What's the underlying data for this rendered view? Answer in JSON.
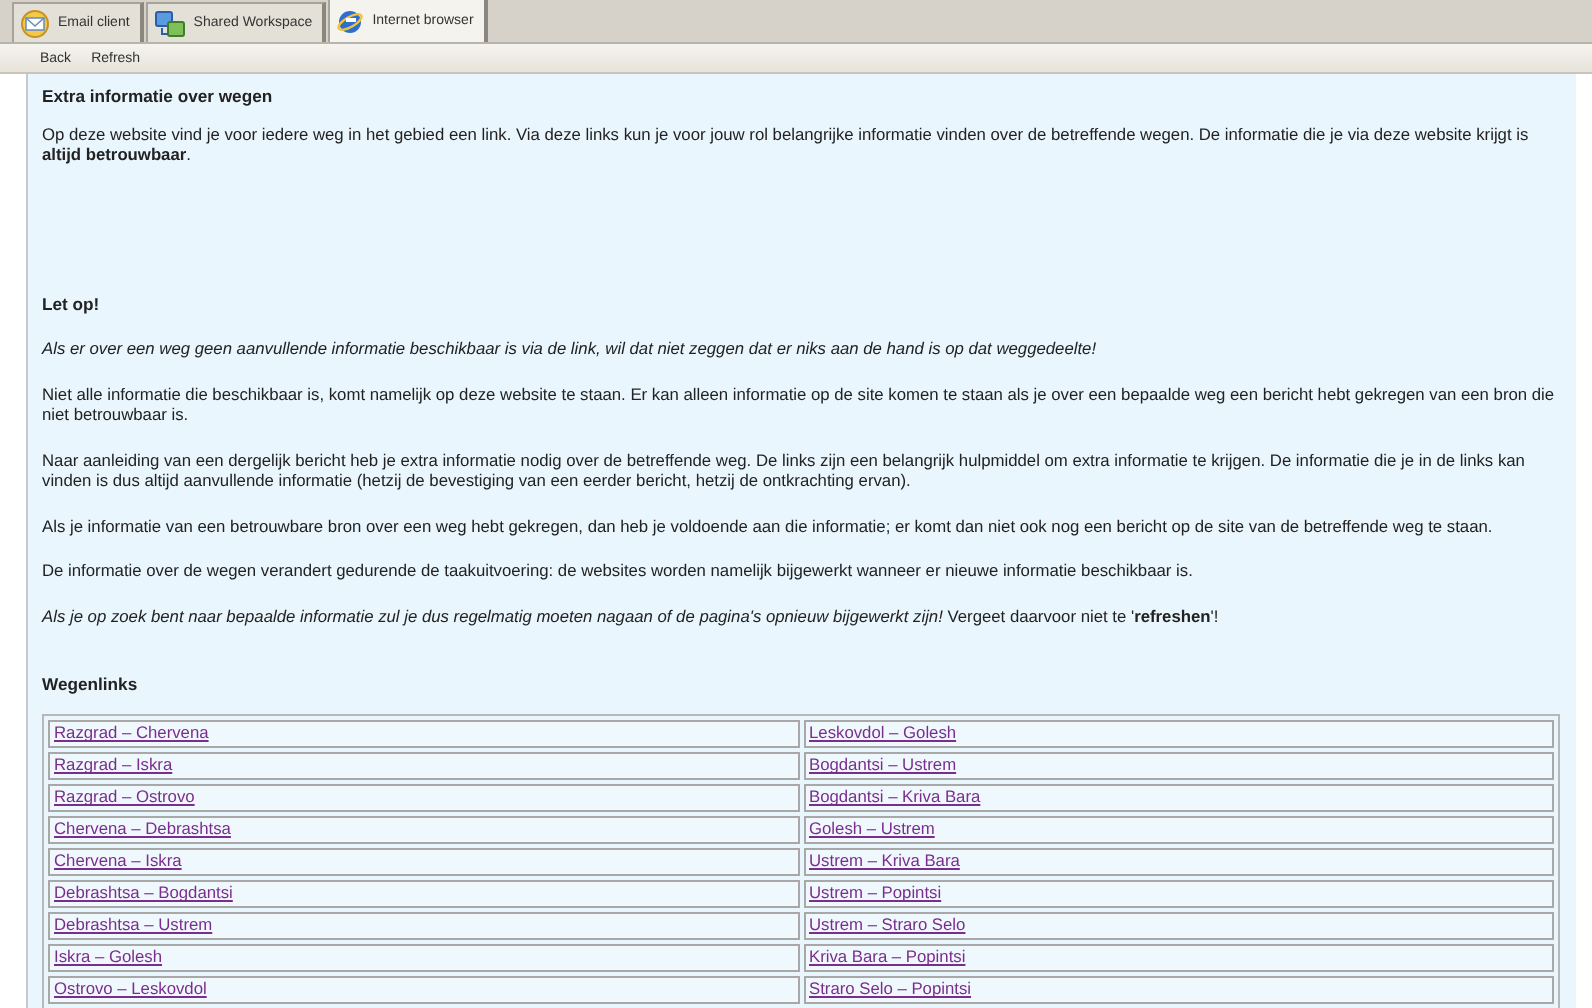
{
  "tabs": [
    {
      "label": "Email client",
      "selected": false
    },
    {
      "label": "Shared Workspace",
      "selected": false
    },
    {
      "label": "Internet browser",
      "selected": true
    }
  ],
  "toolbar": [
    "Back",
    "Refresh"
  ],
  "page": {
    "title": "Extra informatie over wegen",
    "intro": "Op deze website vind je voor iedere weg in het gebied een link. Via deze links kun je voor jouw rol belangrijke informatie vinden over de betreffende wegen. De informatie die je via deze website krijgt is **altijd betrouwbaar**.",
    "notice_title": "Let op!",
    "paragraphs": [
      {
        "kind": "italic",
        "text": "Als er over een weg geen aanvullende informatie beschikbaar is via de link, wil dat niet zeggen dat er niks aan de hand is op dat weggedeelte!"
      },
      {
        "kind": "normal",
        "text": "Niet alle informatie die beschikbaar is, komt namelijk op deze website te staan. Er kan alleen informatie op de site komen te staan als je over een bepaalde weg een bericht hebt gekregen van een bron die niet betrouwbaar is."
      },
      {
        "kind": "normal",
        "text": "Naar aanleiding van een dergelijk bericht heb je extra informatie nodig over de betreffende weg. De links zijn een belangrijk hulpmiddel om extra informatie te krijgen. De informatie die je in de links kan vinden is dus altijd aanvullende informatie (hetzij de bevestiging van een eerder bericht, hetzij de ontkrachting ervan)."
      },
      {
        "kind": "normal",
        "text": "Als je informatie van een betrouwbare bron over een weg hebt gekregen, dan heb je voldoende aan die informatie; er komt dan niet ook nog een bericht op de site van de betreffende weg te staan."
      },
      {
        "kind": "normal",
        "text": "De informatie over de wegen verandert gedurende de taakuitvoering: de websites worden namelijk bijgewerkt wanneer er nieuwe informatie beschikbaar is."
      },
      {
        "kind": "normal",
        "text": "*Als je op zoek bent naar bepaalde informatie zul je dus regelmatig moeten nagaan of de pagina's opnieuw bijgewerkt zijn!*  Vergeet daarvoor niet te '**refreshen**'!"
      }
    ],
    "links_title": "Wegenlinks",
    "links": [
      [
        "Razgrad – Chervena",
        "Leskovdol – Golesh"
      ],
      [
        "Razgrad – Iskra",
        "Bogdantsi – Ustrem"
      ],
      [
        "Razgrad – Ostrovo",
        "Bogdantsi – Kriva Bara"
      ],
      [
        "Chervena – Debrashtsa",
        "Golesh – Ustrem"
      ],
      [
        "Chervena – Iskra",
        "Ustrem – Kriva Bara"
      ],
      [
        "Debrashtsa – Bogdantsi",
        "Ustrem – Popintsi"
      ],
      [
        "Debrashtsa – Ustrem",
        "Ustrem – Straro Selo"
      ],
      [
        "Iskra – Golesh",
        "Kriva Bara – Popintsi"
      ],
      [
        "Ostrovo – Leskovdol",
        "Straro Selo – Popintsi"
      ]
    ]
  }
}
